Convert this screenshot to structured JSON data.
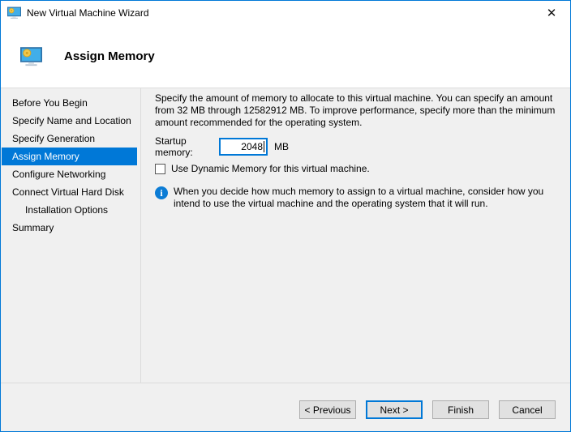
{
  "titlebar": {
    "title": "New Virtual Machine Wizard",
    "close_glyph": "✕"
  },
  "header": {
    "title": "Assign Memory"
  },
  "sidebar": {
    "items": [
      {
        "label": "Before You Begin",
        "selected": false,
        "indent": false
      },
      {
        "label": "Specify Name and Location",
        "selected": false,
        "indent": false
      },
      {
        "label": "Specify Generation",
        "selected": false,
        "indent": false
      },
      {
        "label": "Assign Memory",
        "selected": true,
        "indent": false
      },
      {
        "label": "Configure Networking",
        "selected": false,
        "indent": false
      },
      {
        "label": "Connect Virtual Hard Disk",
        "selected": false,
        "indent": false
      },
      {
        "label": "Installation Options",
        "selected": false,
        "indent": true
      },
      {
        "label": "Summary",
        "selected": false,
        "indent": false
      }
    ]
  },
  "content": {
    "description": "Specify the amount of memory to allocate to this virtual machine. You can specify an amount from 32 MB through 12582912 MB. To improve performance, specify more than the minimum amount recommended for the operating system.",
    "startup_memory": {
      "label": "Startup memory:",
      "value": "2048",
      "unit": "MB"
    },
    "dynamic_memory": {
      "label": "Use Dynamic Memory for this virtual machine.",
      "checked": false
    },
    "info_icon_glyph": "i",
    "info_note": "When you decide how much memory to assign to a virtual machine, consider how you intend to use the virtual machine and the operating system that it will run."
  },
  "footer": {
    "buttons": [
      {
        "label": "< Previous",
        "default": false
      },
      {
        "label": "Next >",
        "default": true
      },
      {
        "label": "Finish",
        "default": false
      },
      {
        "label": "Cancel",
        "default": false
      }
    ]
  },
  "colors": {
    "accent": "#0078d7",
    "window_background": "#f0f0f0",
    "button_background": "#e1e1e1",
    "button_border": "#adadad",
    "selected_item_background": "#0078d7",
    "selected_item_text": "#ffffff"
  }
}
